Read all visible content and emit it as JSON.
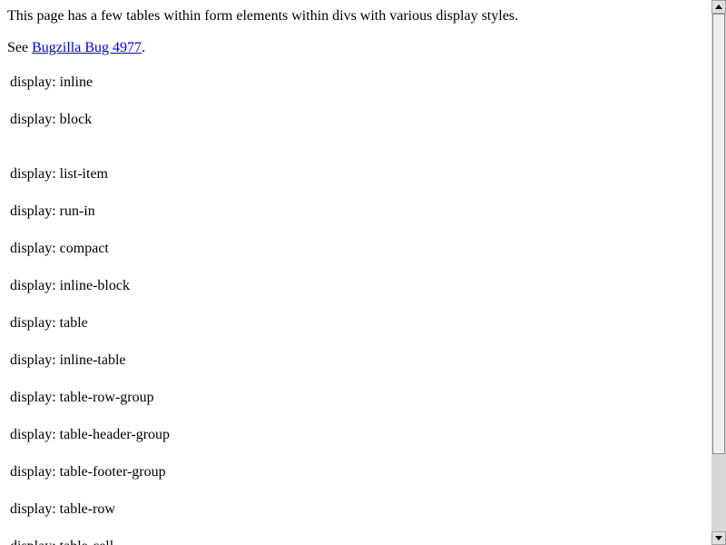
{
  "intro": {
    "text": "This page has a few tables within form elements within divs with various display styles."
  },
  "see": {
    "prefix": "See ",
    "link_label": "Bugzilla Bug 4977",
    "suffix": "."
  },
  "display_items": [
    "display: inline",
    "display: block",
    "display: list-item",
    "display: run-in",
    "display: compact",
    "display: inline-block",
    "display: table",
    "display: inline-table",
    "display: table-row-group",
    "display: table-header-group",
    "display: table-footer-group",
    "display: table-row",
    "display: table-cell"
  ],
  "colors": {
    "link": "#0000ee",
    "scrollbar_track": "#d7d7d7"
  }
}
